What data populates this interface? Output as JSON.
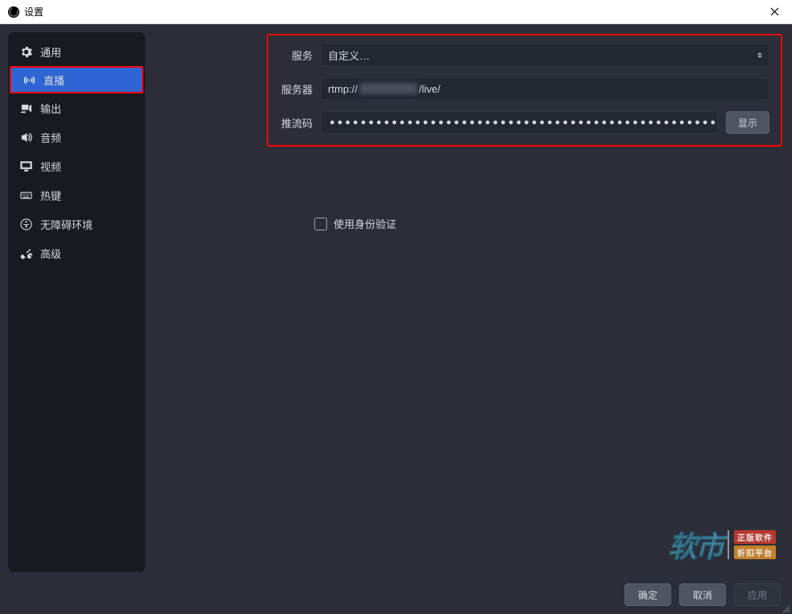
{
  "titlebar": {
    "title": "设置"
  },
  "sidebar": {
    "items": [
      {
        "label": "通用"
      },
      {
        "label": "直播"
      },
      {
        "label": "输出"
      },
      {
        "label": "音频"
      },
      {
        "label": "视频"
      },
      {
        "label": "热键"
      },
      {
        "label": "无障碍环境"
      },
      {
        "label": "高级"
      }
    ],
    "active_index": 1
  },
  "form": {
    "service_label": "服务",
    "service_value": "自定义…",
    "server_label": "服务器",
    "server_prefix": "rtmp://",
    "server_suffix": "/live/",
    "streamkey_label": "推流码",
    "streamkey_masked": "●●●●●●●●●●●●●●●●●●●●●●●●●●●●●●●●●●●●●●●●●●●●●●●●●●●●●●●●●●●",
    "show_button": "显示",
    "auth_checkbox_label": "使用身份验证"
  },
  "footer": {
    "ok": "确定",
    "cancel": "取消",
    "apply": "应用"
  },
  "watermark": {
    "logo": "软市",
    "tag1": "正版软件",
    "tag2": "折扣平台"
  }
}
